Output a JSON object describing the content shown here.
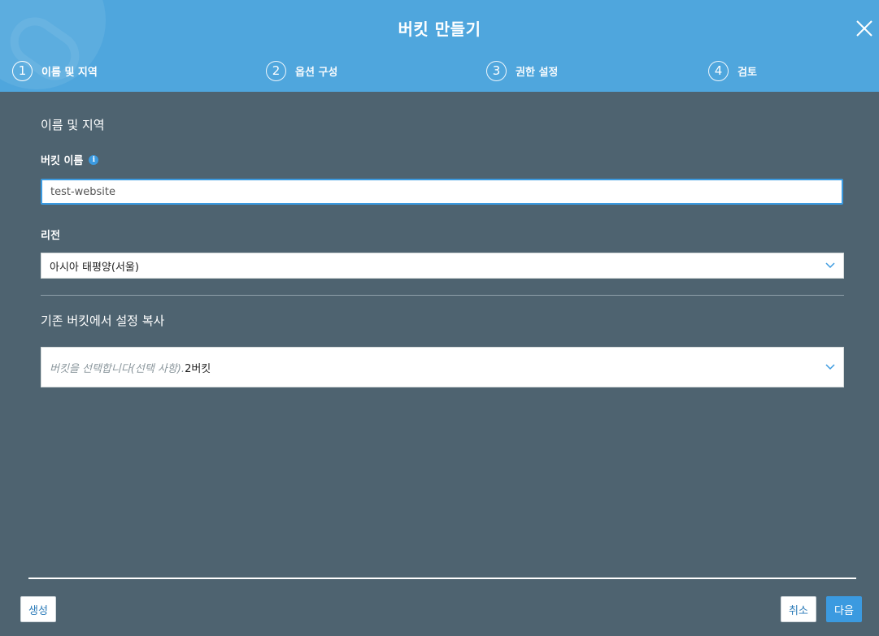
{
  "header": {
    "title": "버킷 만들기",
    "close_icon": "close-icon",
    "steps": [
      {
        "number": "1",
        "label": "이름 및 지역"
      },
      {
        "number": "2",
        "label": "옵션 구성"
      },
      {
        "number": "3",
        "label": "권한 설정"
      },
      {
        "number": "4",
        "label": "검토"
      }
    ]
  },
  "main": {
    "section_title": "이름 및 지역",
    "bucket_name_label": "버킷 이름",
    "bucket_name_info_icon": "info-icon",
    "bucket_name_value": "test-website",
    "region_label": "리전",
    "region_value": "아시아 태평양(서울)",
    "copy_section_title": "기존 버킷에서 설정 복사",
    "copy_placeholder": "버킷을 선택합니다(선택 사항).",
    "copy_count": "2버킷"
  },
  "footer": {
    "create_label": "생성",
    "cancel_label": "취소",
    "next_label": "다음"
  },
  "colors": {
    "header_bg": "#4fa6dd",
    "body_bg": "#4e6370",
    "accent": "#3b9ae0"
  }
}
